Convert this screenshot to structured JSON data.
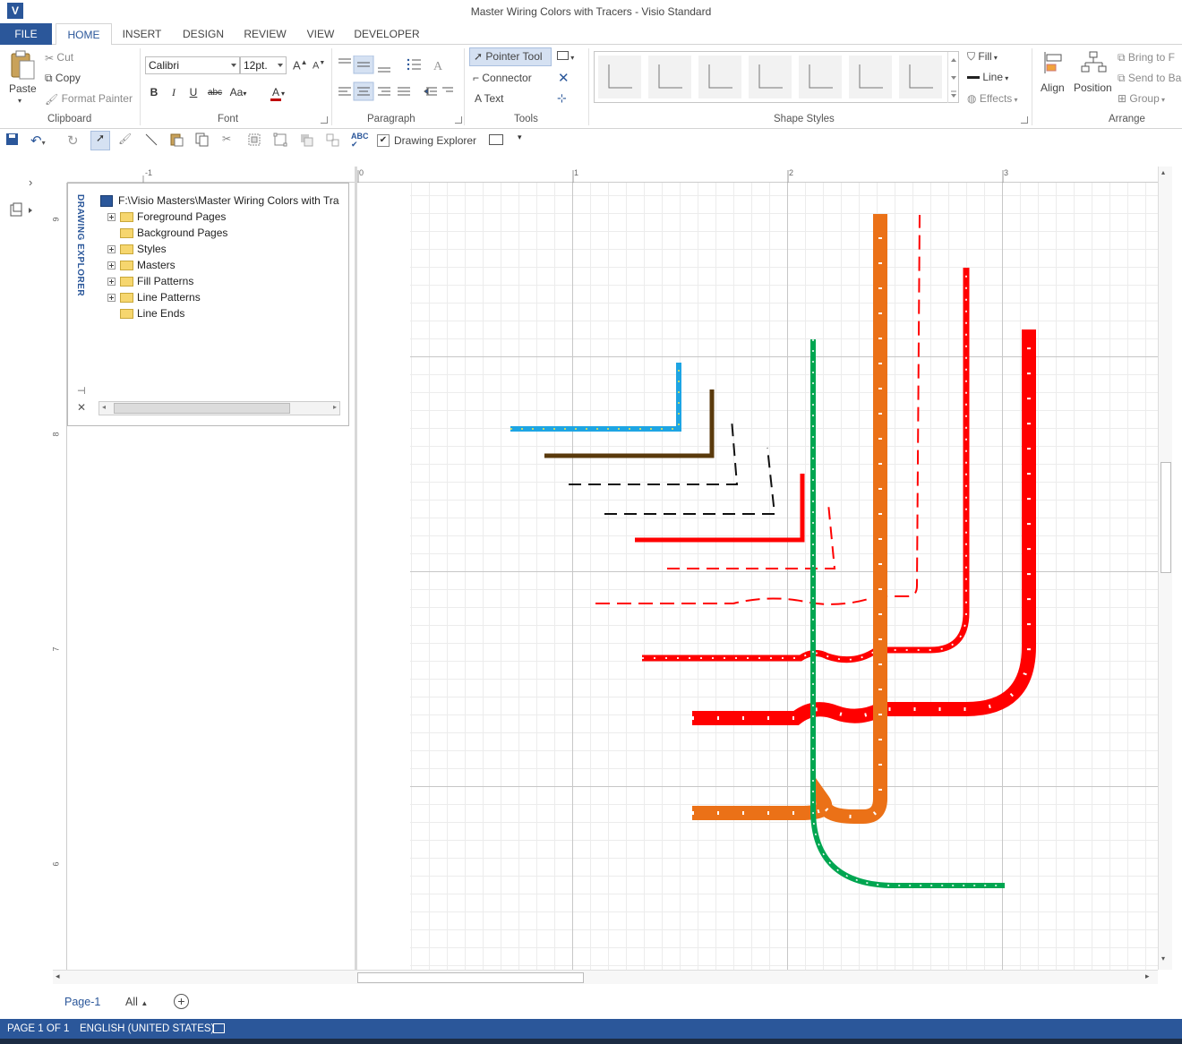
{
  "window": {
    "title": "Master Wiring Colors with Tracers - Visio Standard",
    "app_icon": "V"
  },
  "ribbon_tabs": [
    "FILE",
    "HOME",
    "INSERT",
    "DESIGN",
    "REVIEW",
    "VIEW",
    "DEVELOPER"
  ],
  "clipboard": {
    "paste": "Paste",
    "cut": "Cut",
    "copy": "Copy",
    "format_painter": "Format Painter",
    "label": "Clipboard"
  },
  "font": {
    "name": "Calibri",
    "size": "12pt.",
    "bold": "B",
    "italic": "I",
    "underline": "U",
    "strike": "abc",
    "case": "Aa",
    "grow": "A",
    "shrink": "A",
    "color_glyph": "A",
    "label": "Font"
  },
  "paragraph": {
    "label": "Paragraph"
  },
  "tools": {
    "pointer": "Pointer Tool",
    "connector": "Connector",
    "text": "Text",
    "label": "Tools"
  },
  "shape_styles": {
    "label": "Shape Styles",
    "fill": "Fill",
    "line": "Line",
    "effects": "Effects"
  },
  "arrange": {
    "align": "Align",
    "position": "Position",
    "bring_to_front": "Bring to F",
    "send_to_back": "Send to Ba",
    "group": "Group",
    "label": "Arrange"
  },
  "qat": {
    "drawing_explorer": "Drawing Explorer"
  },
  "explorer": {
    "title": "DRAWING EXPLORER",
    "root": "F:\\Visio Masters\\Master Wiring Colors with Tra",
    "items": [
      {
        "label": "Foreground Pages",
        "expandable": true
      },
      {
        "label": "Background Pages",
        "expandable": false
      },
      {
        "label": "Styles",
        "expandable": true
      },
      {
        "label": "Masters",
        "expandable": true
      },
      {
        "label": "Fill Patterns",
        "expandable": true
      },
      {
        "label": "Line Patterns",
        "expandable": true
      },
      {
        "label": "Line Ends",
        "expandable": false
      }
    ]
  },
  "rulers": {
    "horizontal": [
      "-1",
      "0",
      "1",
      "2",
      "3"
    ],
    "vertical": [
      "9",
      "8",
      "7",
      "6"
    ]
  },
  "wire_colors": {
    "blue": "#1ea5e3",
    "brown": "#5a3a0c",
    "red": "#ff0000",
    "orange": "#eb7117",
    "green": "#00a651",
    "tracer_yellow": "#f5e64b"
  },
  "page_tabs": {
    "current": "Page-1",
    "all": "All"
  },
  "status": {
    "page": "PAGE 1 OF 1",
    "language": "ENGLISH (UNITED STATES)"
  }
}
